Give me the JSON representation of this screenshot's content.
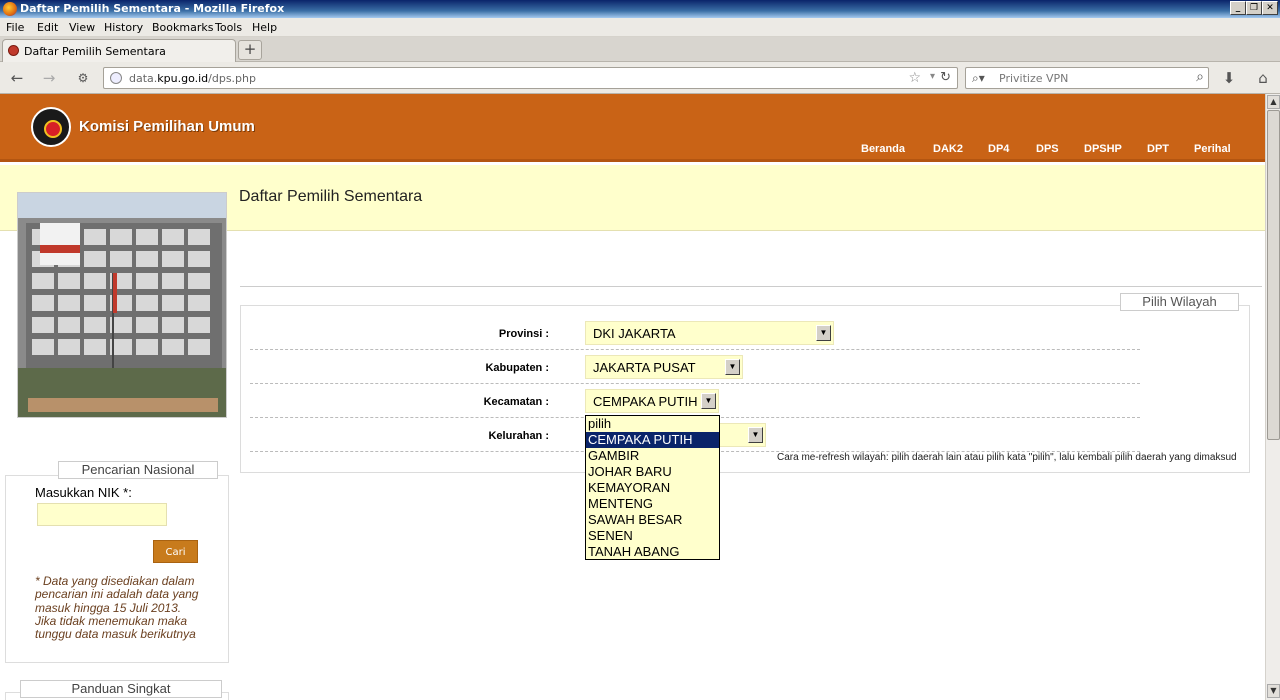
{
  "window": {
    "title": "Daftar Pemilih Sementara - Mozilla Firefox",
    "controls": [
      "_",
      "❐",
      "✕"
    ]
  },
  "menubar": {
    "items": [
      "File",
      "Edit",
      "View",
      "History",
      "Bookmarks",
      "Tools",
      "Help"
    ]
  },
  "tabs": [
    {
      "label": "Daftar Pemilih Sementara",
      "active": true
    }
  ],
  "navbar": {
    "url_prefix": "data.",
    "url_domain": "kpu.go.id",
    "url_path": "/dps.php",
    "search_placeholder": "Privitize VPN",
    "icons": [
      "back-arrow-icon",
      "forward-arrow-icon",
      "history-icon",
      "star-icon",
      "reload-icon",
      "magnifier-icon",
      "download-icon",
      "home-icon"
    ]
  },
  "site": {
    "title": "Komisi Pemilihan Umum",
    "nav": [
      "Beranda",
      "DAK2",
      "DP4",
      "DPS",
      "DPSHP",
      "DPT",
      "Perihal"
    ],
    "header_color": "#c96316",
    "band_color": "#ffffcc"
  },
  "page": {
    "heading": "Daftar Pemilih Sementara"
  },
  "region_form": {
    "legend": "Pilih Wilayah",
    "fields": [
      {
        "label": "Provinsi :",
        "value": "DKI JAKARTA"
      },
      {
        "label": "Kabupaten :",
        "value": "JAKARTA PUSAT"
      },
      {
        "label": "Kecamatan :",
        "value": "CEMPAKA PUTIH"
      },
      {
        "label": "Kelurahan :",
        "value": ""
      }
    ],
    "kecamatan_options": [
      "pilih",
      "CEMPAKA PUTIH",
      "GAMBIR",
      "JOHAR BARU",
      "KEMAYORAN",
      "MENTENG",
      "SAWAH BESAR",
      "SENEN",
      "TANAH ABANG"
    ],
    "selected_option": "CEMPAKA PUTIH",
    "refresh_note": "Cara me-refresh wilayah: pilih daerah lain atau pilih kata \"pilih\", lalu kembali pilih daerah yang dimaksud"
  },
  "national_search": {
    "legend": "Pencarian Nasional",
    "nik_label": "Masukkan NIK *:",
    "nik_value": "",
    "button_label": "Cari",
    "note": "* Data yang disediakan dalam pencarian ini adalah data yang masuk hingga 15 Juli 2013. Jika tidak menemukan maka tunggu data masuk berikutnya"
  },
  "quick_guide": {
    "legend": "Panduan Singkat"
  }
}
